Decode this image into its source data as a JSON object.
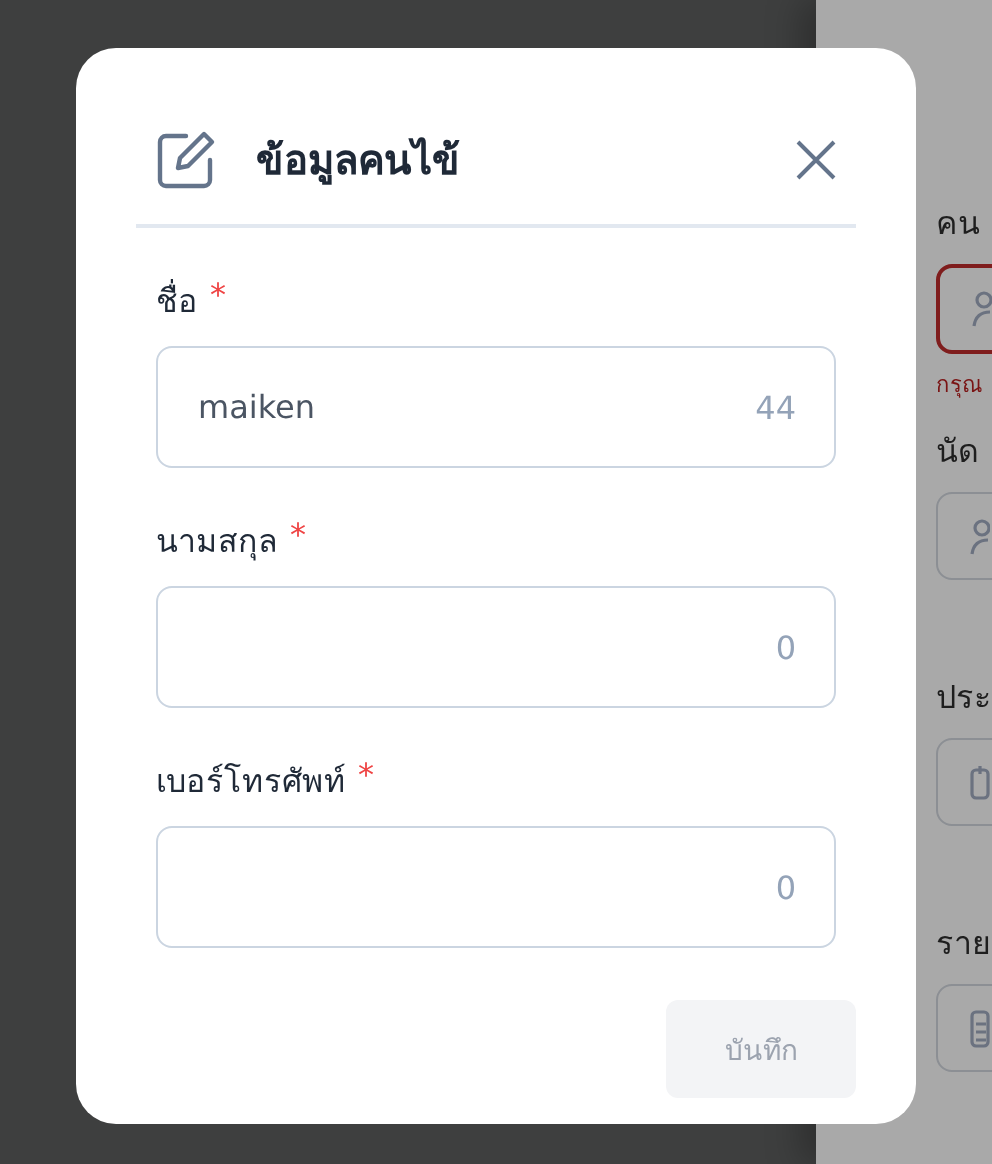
{
  "modal": {
    "title": "ข้อมูลคนไข้",
    "fields": [
      {
        "label": "ชื่อ",
        "required_mark": "*",
        "value": "maiken",
        "counter": "44"
      },
      {
        "label": "นามสกุล",
        "required_mark": "*",
        "counter": "0"
      },
      {
        "label": "เบอร์โทรศัพท์",
        "required_mark": "*",
        "counter": "0"
      }
    ],
    "save_button": {
      "label": "บันทึก",
      "disabled": true
    }
  },
  "side_panel": {
    "items": [
      {
        "kind": "label",
        "text": "คน"
      },
      {
        "kind": "person-field",
        "error": true
      },
      {
        "kind": "error-text",
        "text": "กรุณ"
      },
      {
        "kind": "label",
        "text": "นัด"
      },
      {
        "kind": "person-field",
        "error": false
      },
      {
        "kind": "label",
        "text": "ประ"
      },
      {
        "kind": "calendar-field",
        "error": false
      },
      {
        "kind": "label",
        "text": "ราย"
      },
      {
        "kind": "document-field",
        "error": false
      }
    ]
  }
}
